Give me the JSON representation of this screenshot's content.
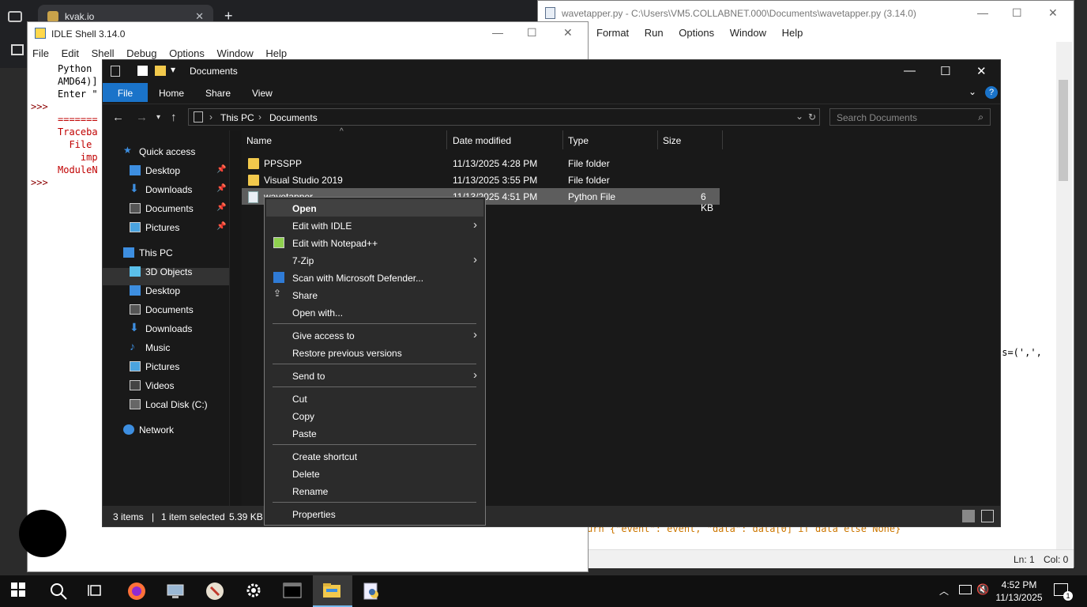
{
  "browser": {
    "tab_title": "kvak.io",
    "tab_close": "✕",
    "new_tab": "+"
  },
  "editor": {
    "title": "wavetapper.py - C:\\Users\\VM5.COLLABNET.000\\Documents\\wavetapper.py (3.14.0)",
    "menu": [
      "Format",
      "Run",
      "Options",
      "Window",
      "Help"
    ],
    "code_line_1": "ts=(',',",
    "code_line_2": "urn {\"event\": event, \"data\": data[0] if data else None}",
    "status_ln": "Ln: 1",
    "status_col": "Col: 0"
  },
  "idle": {
    "title": "IDLE Shell 3.14.0",
    "menu": [
      "File",
      "Edit",
      "Shell",
      "Debug",
      "Options",
      "Window",
      "Help"
    ],
    "prompts": [
      ">>>",
      ">>>",
      ">>>"
    ],
    "lines": [
      "Python",
      "AMD64)]",
      "Enter \"",
      "=======",
      "Traceba",
      "  File",
      "    imp",
      "ModuleN"
    ]
  },
  "explorer": {
    "title": "Documents",
    "ribbon_tabs": [
      "File",
      "Home",
      "Share",
      "View"
    ],
    "breadcrumb": [
      "This PC",
      "Documents"
    ],
    "search_placeholder": "Search Documents",
    "nav": {
      "quick_access": "Quick access",
      "quick_items": [
        "Desktop",
        "Downloads",
        "Documents",
        "Pictures"
      ],
      "this_pc": "This PC",
      "pc_items": [
        "3D Objects",
        "Desktop",
        "Documents",
        "Downloads",
        "Music",
        "Pictures",
        "Videos",
        "Local Disk (C:)"
      ],
      "network": "Network"
    },
    "columns": [
      "Name",
      "Date modified",
      "Type",
      "Size"
    ],
    "files": [
      {
        "name": "PPSSPP",
        "date": "11/13/2025 4:28 PM",
        "type": "File folder",
        "size": ""
      },
      {
        "name": "Visual Studio 2019",
        "date": "11/13/2025 3:55 PM",
        "type": "File folder",
        "size": ""
      },
      {
        "name": "wavetapper",
        "date": "11/13/2025 4:51 PM",
        "type": "Python File",
        "size": "6 KB"
      }
    ],
    "status_items": "3 items",
    "status_selected": "1 item selected",
    "status_size": "5.39 KB"
  },
  "context_menu": {
    "items": [
      "Open",
      "Edit with IDLE",
      "Edit with Notepad++",
      "7-Zip",
      "Scan with Microsoft Defender...",
      "Share",
      "Open with...",
      "Give access to",
      "Restore previous versions",
      "Send to",
      "Cut",
      "Copy",
      "Paste",
      "Create shortcut",
      "Delete",
      "Rename",
      "Properties"
    ]
  },
  "taskbar": {
    "time": "4:52 PM",
    "date": "11/13/2025",
    "notif_count": "1"
  },
  "colors": {
    "explorer_bg": "#191919",
    "file_tab": "#1a73c9",
    "selected_row": "#5d5d5d",
    "menu_bg": "#2b2b2b"
  }
}
